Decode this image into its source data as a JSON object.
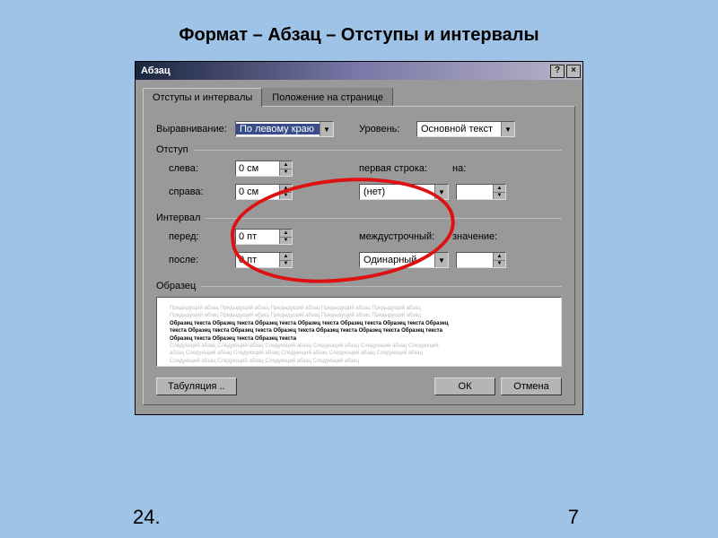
{
  "slide": {
    "title": "Формат – Абзац – Отступы и интервалы",
    "bottom_left": "24.",
    "bottom_right": "7"
  },
  "dialog": {
    "title": "Абзац",
    "titlebar": {
      "help": "?",
      "close": "×"
    },
    "tabs": {
      "indents": "Отступы и интервалы",
      "position": "Положение на странице"
    },
    "alignment": {
      "label": "Выравнивание:",
      "value": "По левому краю"
    },
    "level": {
      "label": "Уровень:",
      "value": "Основной текст"
    },
    "indentation": {
      "header": "Отступ",
      "left": {
        "label": "слева:",
        "value": "0 см"
      },
      "right": {
        "label": "справа:",
        "value": "0 см"
      },
      "firstline_label": "первая строка:",
      "firstline_value": "(нет)",
      "by_label": "на:",
      "by_value": ""
    },
    "spacing": {
      "header": "Интервал",
      "before": {
        "label": "перед:",
        "value": "0 пт"
      },
      "after": {
        "label": "после:",
        "value": "0 пт"
      },
      "line_label": "междустрочный:",
      "line_value": "Одинарный",
      "at_label": "значение:",
      "at_value": ""
    },
    "preview": {
      "header": "Образец",
      "faint1": "Предыдущий абзац Предыдущий абзац Предыдущий абзац Предыдущий абзац Предыдущий абзац",
      "faint2": "Предыдущий абзац Предыдущий абзац Предыдущий абзац Предыдущий абзац Предыдущий абзац",
      "bold1": "Образец текста Образец текста Образец текста Образец текста Образец текста Образец текста Образец",
      "bold2": "текста Образец текста Образец текста Образец текста Образец текста Образец текста Образец текста",
      "bold3": "Образец текста Образец текста Образец текста",
      "faint3": "Следующий абзац Следующий абзац Следующий абзац Следующий абзац Следующий абзац Следующий",
      "faint4": "абзац Следующий абзац Следующий абзац Следующий абзац Следующий абзац Следующий абзац",
      "faint5": "Следующий абзац Следующий абзац Следующий абзац Следующий абзац"
    },
    "buttons": {
      "tabs": "Табуляция ..",
      "ok": "ОК",
      "cancel": "Отмена"
    }
  }
}
